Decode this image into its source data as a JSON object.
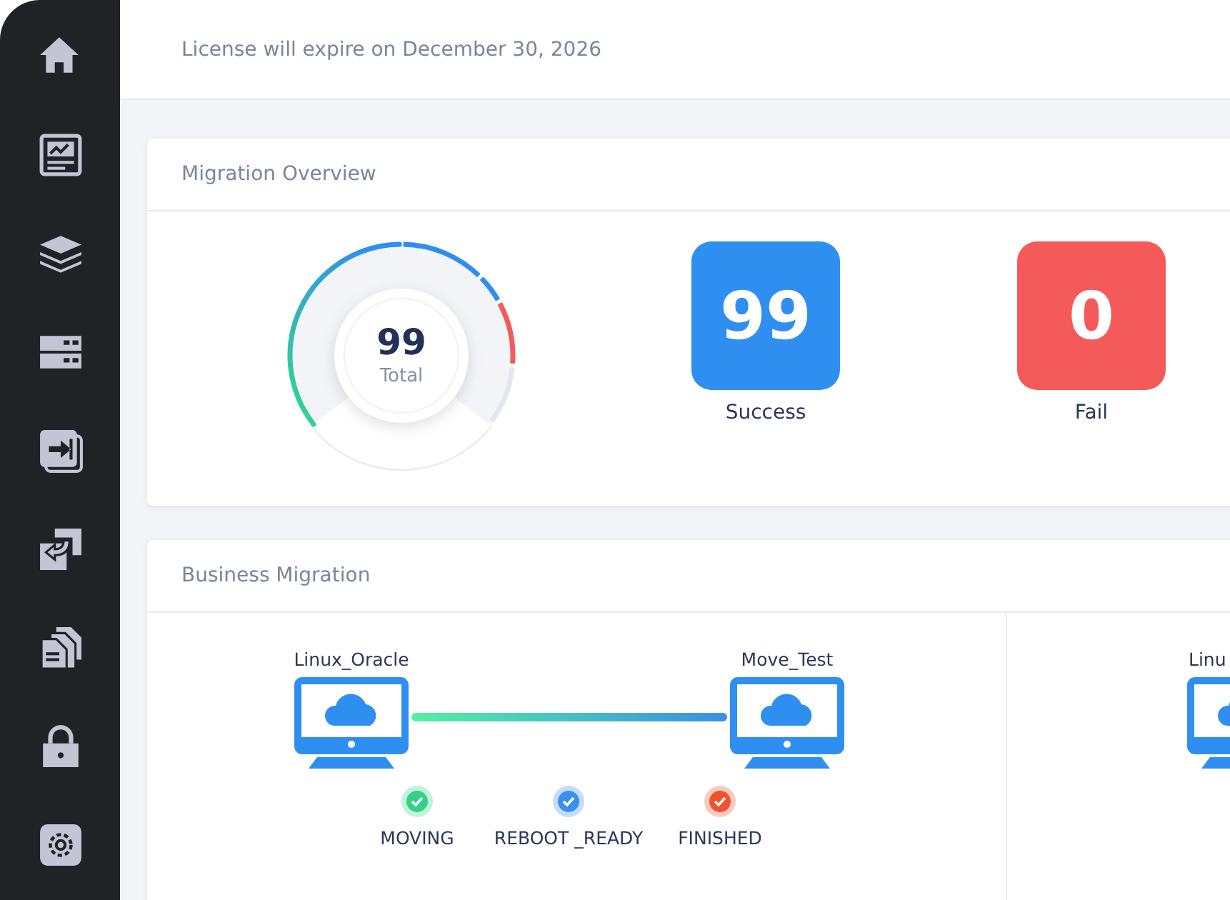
{
  "license_notice": "License will expire on December 30, 2026",
  "overview": {
    "title": "Migration Overview",
    "gauge": {
      "value": "99",
      "label": "Total"
    },
    "tiles": [
      {
        "value": "99",
        "label": "Success",
        "color": "#2f8ff0"
      },
      {
        "value": "0",
        "label": "Fail",
        "color": "#f55a5a"
      }
    ]
  },
  "business": {
    "title": "Business Migration",
    "flows": [
      {
        "source": "Linux_Oracle",
        "target": "Move_Test",
        "statuses": [
          {
            "label": "MOVING",
            "color": "#35cf8a"
          },
          {
            "label": "REBOOT _READY",
            "color": "#3a8ff0"
          },
          {
            "label": "FINISHED",
            "color": "#f0522f"
          }
        ]
      },
      {
        "source": "Linu"
      }
    ]
  }
}
